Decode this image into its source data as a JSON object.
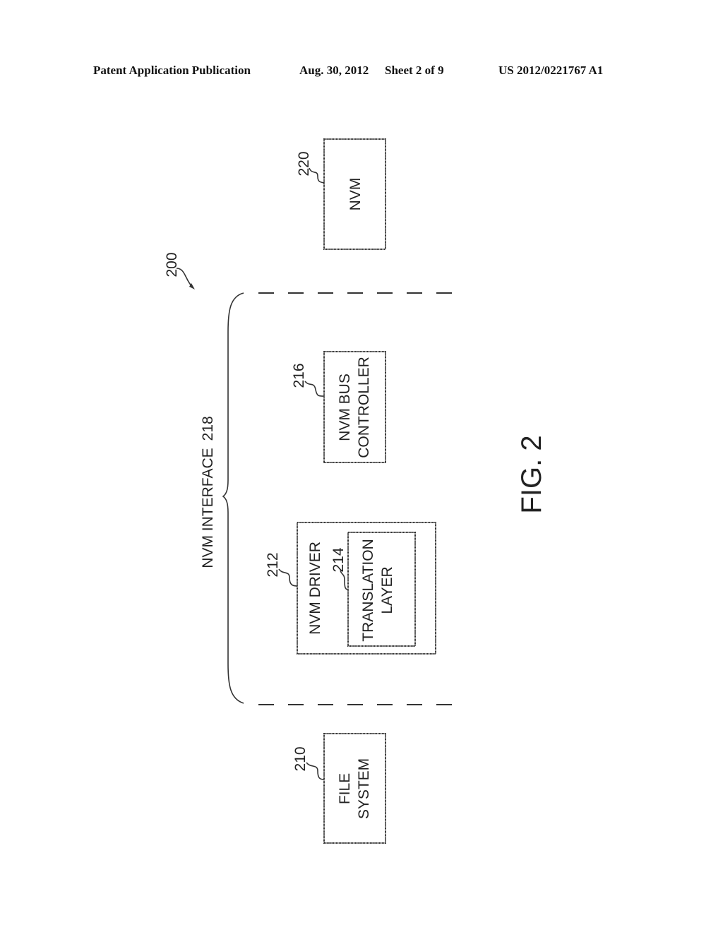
{
  "header": {
    "publication": "Patent Application Publication",
    "date": "Aug. 30, 2012",
    "sheet": "Sheet 2 of 9",
    "pub_number": "US 2012/0221767 A1"
  },
  "figure": {
    "caption": "FIG. 2",
    "system_ref": "200",
    "interface": {
      "label": "NVM INTERFACE",
      "ref": "218"
    },
    "blocks": {
      "file_system": {
        "lines": [
          "FILE",
          "SYSTEM"
        ],
        "ref": "210"
      },
      "nvm_driver": {
        "label": "NVM DRIVER",
        "ref": "212"
      },
      "translation_layer": {
        "lines": [
          "TRANSLATION",
          "LAYER"
        ],
        "ref": "214"
      },
      "nvm_bus_controller": {
        "lines": [
          "NVM BUS",
          "CONTROLLER"
        ],
        "ref": "216"
      },
      "nvm": {
        "label": "NVM",
        "ref": "220"
      }
    }
  }
}
